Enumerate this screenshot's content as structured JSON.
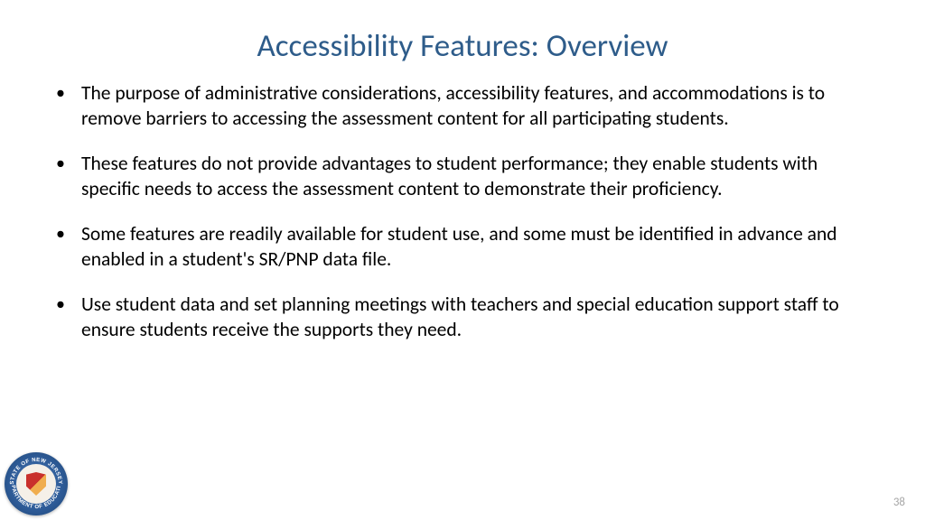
{
  "title": "Accessibility Features: Overview",
  "bullets": [
    "The purpose of administrative considerations, accessibility features, and accommodations is to remove barriers to accessing the assessment content for all participating students.",
    "These features do not provide advantages to student performance; they enable students with specific needs to access the assessment content to demonstrate their proficiency.",
    "Some features are readily available for student use, and some must be identified in advance and enabled in a student's SR/PNP data file.",
    "Use student data and set planning meetings with teachers and special education support staff to ensure students receive the supports they need."
  ],
  "page_number": "38",
  "seal": {
    "top_text": "STATE OF NEW JERSEY",
    "bottom_text": "DEPARTMENT OF EDUCATION"
  }
}
